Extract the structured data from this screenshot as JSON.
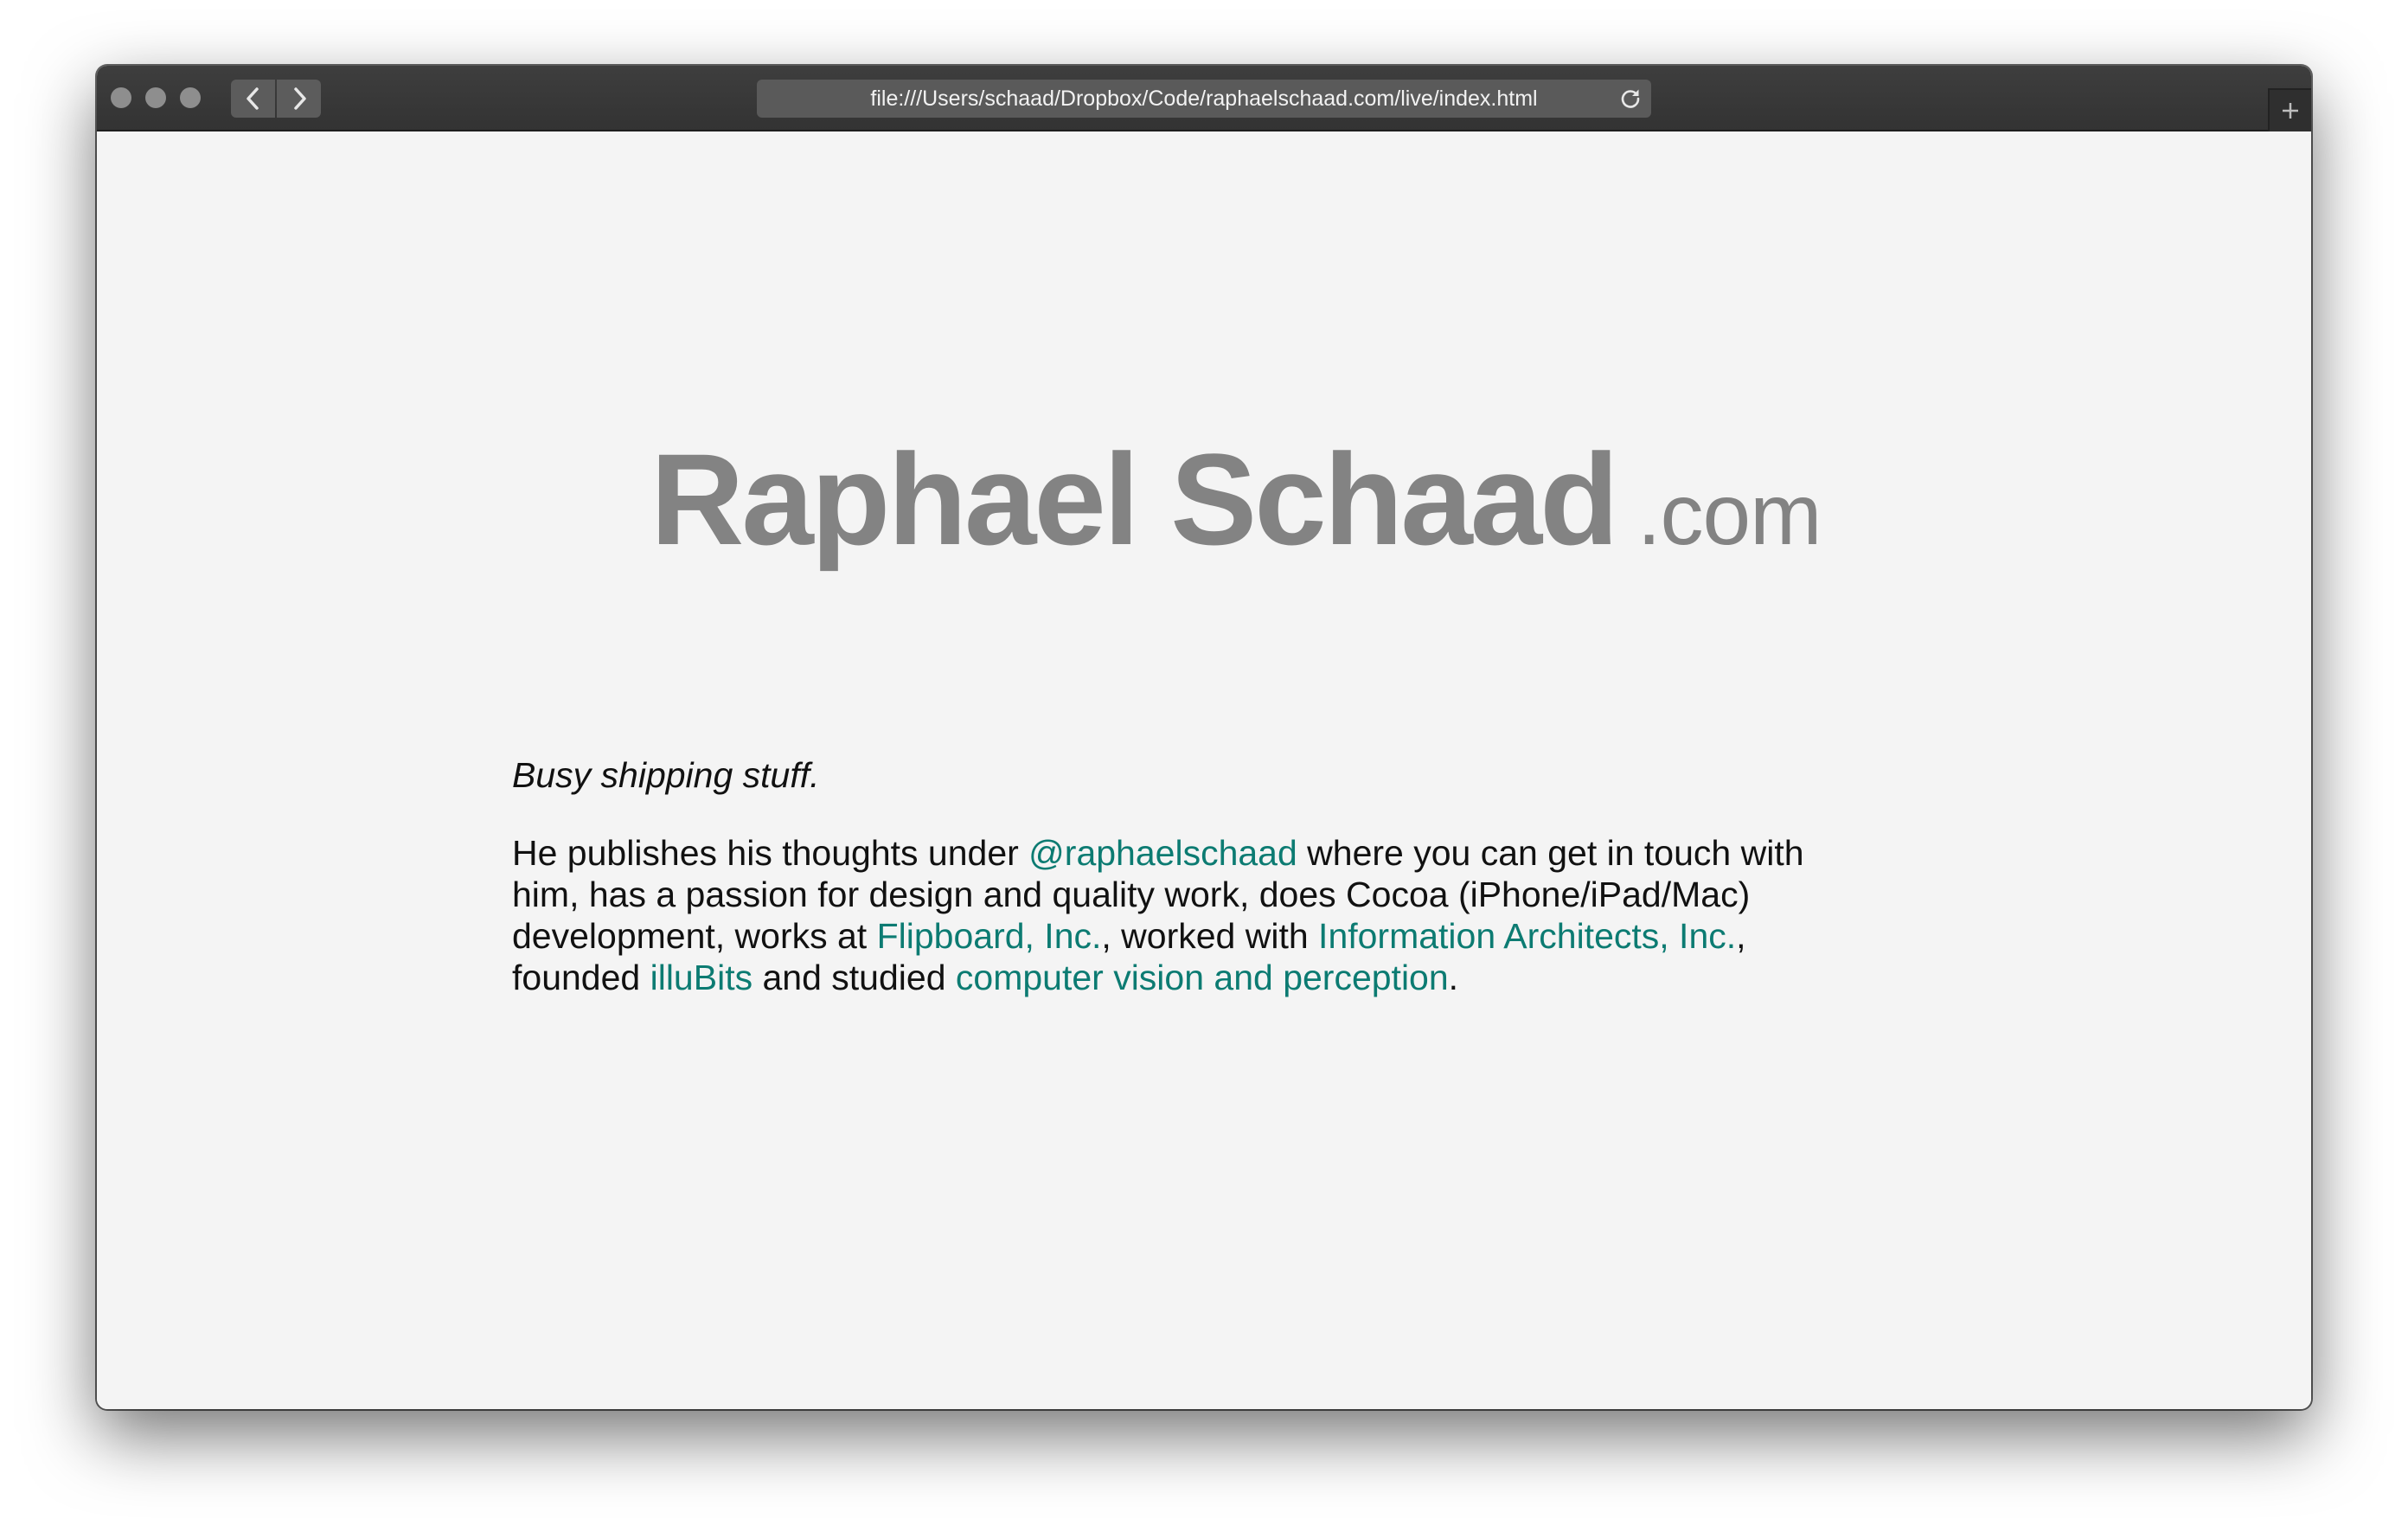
{
  "browser": {
    "url": "file:///Users/schaad/Dropbox/Code/raphaelschaad.com/live/index.html",
    "icons": {
      "back": "chevron-left-icon",
      "forward": "chevron-right-icon",
      "reload": "reload-icon",
      "new_tab": "plus-icon"
    }
  },
  "site": {
    "name": "Raphael Schaad",
    "tld": ".com",
    "tagline": "Busy shipping stuff.",
    "bio": {
      "t1": "He publishes his thoughts under ",
      "link_twitter": "@raphaelschaad",
      "t2": " where you can get in touch with him, has a passion for design and quality work, does Cocoa (iPhone/iPad/Mac) development, works at ",
      "link_flipboard": "Flipboard, Inc.",
      "t3": ", worked with ",
      "link_ia": "Information Architects, Inc.",
      "t4": ", founded ",
      "link_illubits": "illuBits",
      "t5": " and studied ",
      "link_cv": "computer vision and perception",
      "t6": "."
    }
  },
  "colors": {
    "link": "#0c7b72",
    "logo": "#838383",
    "page_bg": "#f4f4f4"
  }
}
